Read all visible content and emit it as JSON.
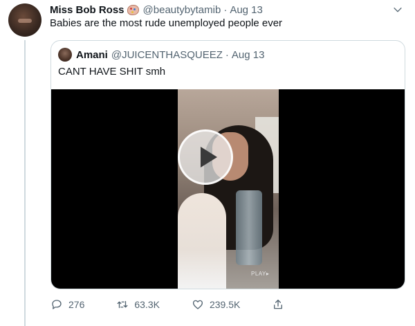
{
  "tweet": {
    "name": "Miss Bob Ross",
    "handle": "@beautybytamib",
    "separator": "·",
    "date": "Aug 13",
    "text": "Babies are the most rude unemployed people ever"
  },
  "quote": {
    "name": "Amani",
    "handle": "@JUICENTHASQUEEZ",
    "separator": "·",
    "date": "Aug 13",
    "text": "CANT HAVE SHIT smh",
    "video_overlay_text": "PLAY▸"
  },
  "actions": {
    "replies": "276",
    "retweets": "63.3K",
    "likes": "239.5K"
  },
  "icons": {
    "menu": "chevron-down-icon",
    "reply": "reply-icon",
    "retweet": "retweet-icon",
    "like": "heart-icon",
    "share": "share-icon",
    "play": "play-icon"
  },
  "colors": {
    "text": "#0f1419",
    "secondary": "#536471",
    "border": "#cfd9de"
  }
}
